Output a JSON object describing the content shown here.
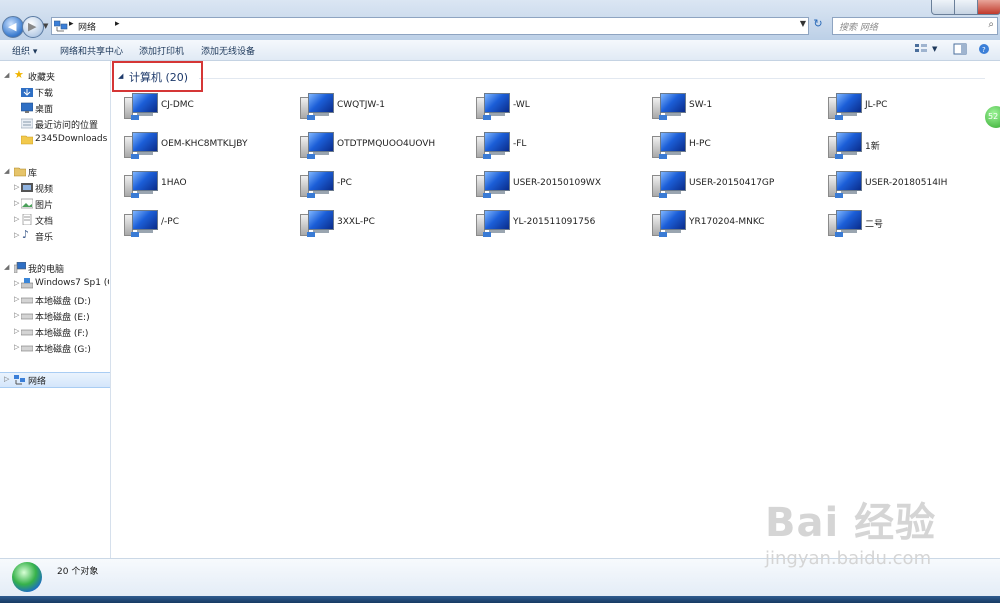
{
  "address": {
    "location": "网络"
  },
  "search": {
    "placeholder": "搜索 网络"
  },
  "toolbar": {
    "organize": "组织 ▾",
    "network_center": "网络和共享中心",
    "add_printer": "添加打印机",
    "add_wireless": "添加无线设备"
  },
  "sidebar": {
    "favorites": {
      "label": "收藏夹",
      "items": [
        {
          "label": "下载"
        },
        {
          "label": "桌面"
        },
        {
          "label": "最近访问的位置"
        },
        {
          "label": "2345Downloads"
        }
      ]
    },
    "libraries": {
      "label": "库",
      "items": [
        {
          "label": "视频"
        },
        {
          "label": "图片"
        },
        {
          "label": "文档"
        },
        {
          "label": "音乐"
        }
      ]
    },
    "computer": {
      "label": "我的电脑",
      "items": [
        {
          "label": "Windows7 Sp1 (C:"
        },
        {
          "label": "本地磁盘 (D:)"
        },
        {
          "label": "本地磁盘 (E:)"
        },
        {
          "label": "本地磁盘 (F:)"
        },
        {
          "label": "本地磁盘 (G:)"
        }
      ]
    },
    "network": {
      "label": "网络"
    }
  },
  "group": {
    "title": "计算机 (20)"
  },
  "computers": [
    {
      "label": "CJ-DMC"
    },
    {
      "label": "CWQTJW-1"
    },
    {
      "label": "-WL"
    },
    {
      "label": "SW-1"
    },
    {
      "label": "JL-PC"
    },
    {
      "label": "OEM-KHC8MTKLJBY"
    },
    {
      "label": "OTDTPMQUOO4UOVH"
    },
    {
      "label": "-FL"
    },
    {
      "label": "H-PC"
    },
    {
      "label": "1新"
    },
    {
      "label": "1HAO"
    },
    {
      "label": "-PC"
    },
    {
      "label": "USER-20150109WX"
    },
    {
      "label": "USER-20150417GP"
    },
    {
      "label": "USER-20180514IH"
    },
    {
      "label": "/-PC"
    },
    {
      "label": "3XXL-PC"
    },
    {
      "label": "YL-201511091756"
    },
    {
      "label": "YR170204-MNKC"
    },
    {
      "label": "二号"
    }
  ],
  "status": {
    "count": "20 个对象"
  },
  "overlay": {
    "badge": "52"
  },
  "watermark": {
    "brand": "Bai 经验",
    "url": "jingyan.baidu.com"
  }
}
